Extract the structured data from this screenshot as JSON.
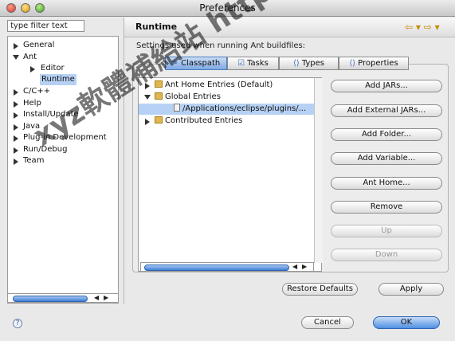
{
  "window": {
    "title": "Preferences"
  },
  "filter": {
    "value": "type filter text"
  },
  "nav": {
    "items": [
      {
        "label": "General"
      },
      {
        "label": "Ant"
      },
      {
        "label": "Editor"
      },
      {
        "label": "Runtime"
      },
      {
        "label": "C/C++"
      },
      {
        "label": "Help"
      },
      {
        "label": "Install/Update"
      },
      {
        "label": "Java"
      },
      {
        "label": "Plug-in Development"
      },
      {
        "label": "Run/Debug"
      },
      {
        "label": "Team"
      }
    ]
  },
  "page": {
    "title": "Runtime",
    "description": "Settings used when running Ant buildfiles:"
  },
  "tabs": [
    {
      "label": "Classpath"
    },
    {
      "label": "Tasks"
    },
    {
      "label": "Types"
    },
    {
      "label": "Properties"
    }
  ],
  "classpath_tree": [
    {
      "label": "Ant Home Entries (Default)"
    },
    {
      "label": "Global Entries"
    },
    {
      "label": "/Applications/eclipse/plugins/..."
    },
    {
      "label": "Contributed Entries"
    }
  ],
  "side_buttons": {
    "add_jars": "Add JARs...",
    "add_external_jars": "Add External JARs...",
    "add_folder": "Add Folder...",
    "add_variable": "Add Variable...",
    "ant_home": "Ant Home...",
    "remove": "Remove",
    "up": "Up",
    "down": "Down"
  },
  "footer": {
    "restore_defaults": "Restore Defaults",
    "apply": "Apply",
    "cancel": "Cancel",
    "ok": "OK",
    "help": "?"
  },
  "watermark": {
    "text": "xyz軟體補給站 http://31.to"
  },
  "colors": {
    "accent": "#4f8fe2",
    "selection": "#b6d1f3"
  }
}
